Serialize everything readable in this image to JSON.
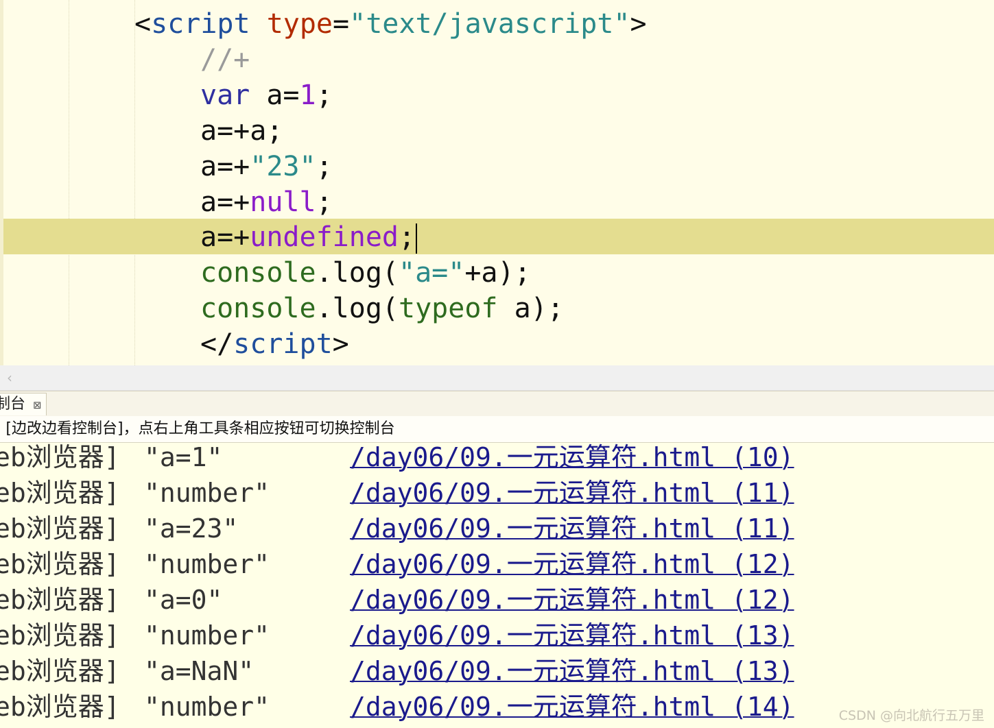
{
  "editor": {
    "lines": [
      {
        "parts": [
          [
            "tag",
            "<"
          ],
          [
            "kw-tag",
            "script"
          ],
          [
            "plain",
            " "
          ],
          [
            "kw-attr",
            "type"
          ],
          [
            "plain",
            "="
          ],
          [
            "str",
            "\"text/javascript\""
          ],
          [
            "tag",
            ">"
          ]
        ]
      },
      {
        "parts": [
          [
            "cmt",
            "//+"
          ]
        ]
      },
      {
        "parts": [
          [
            "kw",
            "var"
          ],
          [
            "plain",
            " a="
          ],
          [
            "num",
            "1"
          ],
          [
            "plain",
            ";"
          ]
        ]
      },
      {
        "parts": [
          [
            "plain",
            "a=+a;"
          ]
        ]
      },
      {
        "parts": [
          [
            "plain",
            "a=+"
          ],
          [
            "str",
            "\"23\""
          ],
          [
            "plain",
            ";"
          ]
        ]
      },
      {
        "parts": [
          [
            "plain",
            "a=+"
          ],
          [
            "lit",
            "null"
          ],
          [
            "plain",
            ";"
          ]
        ]
      },
      {
        "parts": [
          [
            "plain",
            "a=+"
          ],
          [
            "lit",
            "undefined"
          ],
          [
            "plain",
            ";"
          ]
        ]
      },
      {
        "parts": [
          [
            "fn",
            "console"
          ],
          [
            "plain",
            "."
          ],
          [
            "plain",
            "log("
          ],
          [
            "str",
            "\"a=\""
          ],
          [
            "plain",
            "+a);"
          ]
        ]
      },
      {
        "parts": [
          [
            "fn",
            "console"
          ],
          [
            "plain",
            "."
          ],
          [
            "plain",
            "log("
          ],
          [
            "fn",
            "typeof"
          ],
          [
            "plain",
            " a);"
          ]
        ]
      },
      {
        "parts": [
          [
            "tag",
            "</"
          ],
          [
            "kw-tag",
            "script"
          ],
          [
            "tag",
            ">"
          ]
        ]
      }
    ]
  },
  "scrollbar": {
    "left_arrow": "‹"
  },
  "console_tab": {
    "label": "制台",
    "close": "⊠"
  },
  "hint": ": [边改边看控制台]，点右上角工具条相应按钮可切换控制台",
  "console": {
    "rows": [
      {
        "source": "eb浏览器]",
        "message": "\"a=1\"",
        "link": "/day06/09.一元运算符.html (10)"
      },
      {
        "source": "eb浏览器]",
        "message": "\"number\"",
        "link": "/day06/09.一元运算符.html (11)"
      },
      {
        "source": "eb浏览器]",
        "message": "\"a=23\"",
        "link": "/day06/09.一元运算符.html (11)"
      },
      {
        "source": "eb浏览器]",
        "message": "\"number\"",
        "link": "/day06/09.一元运算符.html (12)"
      },
      {
        "source": "eb浏览器]",
        "message": "\"a=0\"",
        "link": "/day06/09.一元运算符.html (12)"
      },
      {
        "source": "eb浏览器]",
        "message": "\"number\"",
        "link": "/day06/09.一元运算符.html (13)"
      },
      {
        "source": "eb浏览器]",
        "message": "\"a=NaN\"",
        "link": "/day06/09.一元运算符.html (13)"
      },
      {
        "source": "eb浏览器]",
        "message": "\"number\"",
        "link": "/day06/09.一元运算符.html (14)"
      }
    ]
  },
  "watermark": "CSDN @向北航行五万里"
}
